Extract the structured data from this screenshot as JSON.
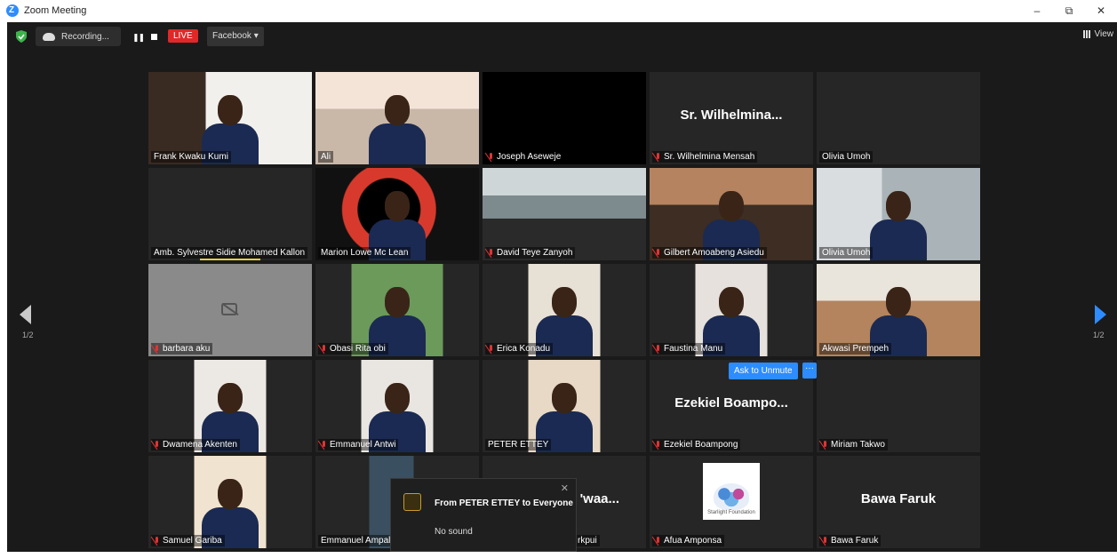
{
  "window": {
    "title": "Zoom Meeting",
    "min": "–",
    "restore": "⧉",
    "close": "✕"
  },
  "toolbar": {
    "recording_label": "Recording...",
    "pause": "❚❚",
    "live_label": "LIVE",
    "stream_target": "Facebook ▾",
    "view_label": "View"
  },
  "nav": {
    "page_left": "1/2",
    "page_right": "1/2"
  },
  "participants": [
    {
      "name": "Frank Kwaku Kumi",
      "muted": false
    },
    {
      "name": "Ali",
      "muted": false
    },
    {
      "name": "Joseph Aseweje",
      "muted": true
    },
    {
      "name": "Sr. Wilhelmina Mensah",
      "muted": true,
      "display": "Sr.  Wilhelmina..."
    },
    {
      "name": "Olivia Umoh",
      "muted": false
    },
    {
      "name": "Amb. Sylvestre Sidie Mohamed Kallon",
      "muted": false
    },
    {
      "name": "Marion Lowe Mc Lean",
      "muted": false
    },
    {
      "name": "David Teye Zanyoh",
      "muted": true
    },
    {
      "name": "Gilbert Amoabeng Asiedu",
      "muted": true
    },
    {
      "name": "Olivia Umoh",
      "muted": false
    },
    {
      "name": "barbara aku",
      "muted": true
    },
    {
      "name": "Obasi Rita obi",
      "muted": true
    },
    {
      "name": "Erica Konadu",
      "muted": true
    },
    {
      "name": "Faustina Manu",
      "muted": true
    },
    {
      "name": "Akwasi Prempeh",
      "muted": false
    },
    {
      "name": "Dwamena Akenten",
      "muted": true
    },
    {
      "name": "Emmanuel Antwi",
      "muted": true
    },
    {
      "name": "PETER ETTEY",
      "muted": false
    },
    {
      "name": "Ezekiel Boampong",
      "muted": true,
      "display": "Ezekiel  Boampo..."
    },
    {
      "name": "Miriam Takwo",
      "muted": true
    },
    {
      "name": "Samuel Gariba",
      "muted": true
    },
    {
      "name": "Emmanuel Ampal",
      "muted": false
    },
    {
      "name": "rkpui",
      "muted": false,
      "display": "'waa..."
    },
    {
      "name": "Afua Amponsa",
      "muted": true
    },
    {
      "name": "Bawa Faruk",
      "muted": true,
      "display": "Bawa Faruk"
    }
  ],
  "ask_unmute": "Ask to Unmute",
  "more": "···",
  "chat": {
    "from": "From PETER ETTEY to Everyone",
    "message": "No sound",
    "close": "✕"
  },
  "logo": {
    "text": "Starlight Foundation"
  },
  "colors": {
    "accent": "#2d8cff",
    "live": "#e02828",
    "active_speaker": "#c8e35a"
  }
}
